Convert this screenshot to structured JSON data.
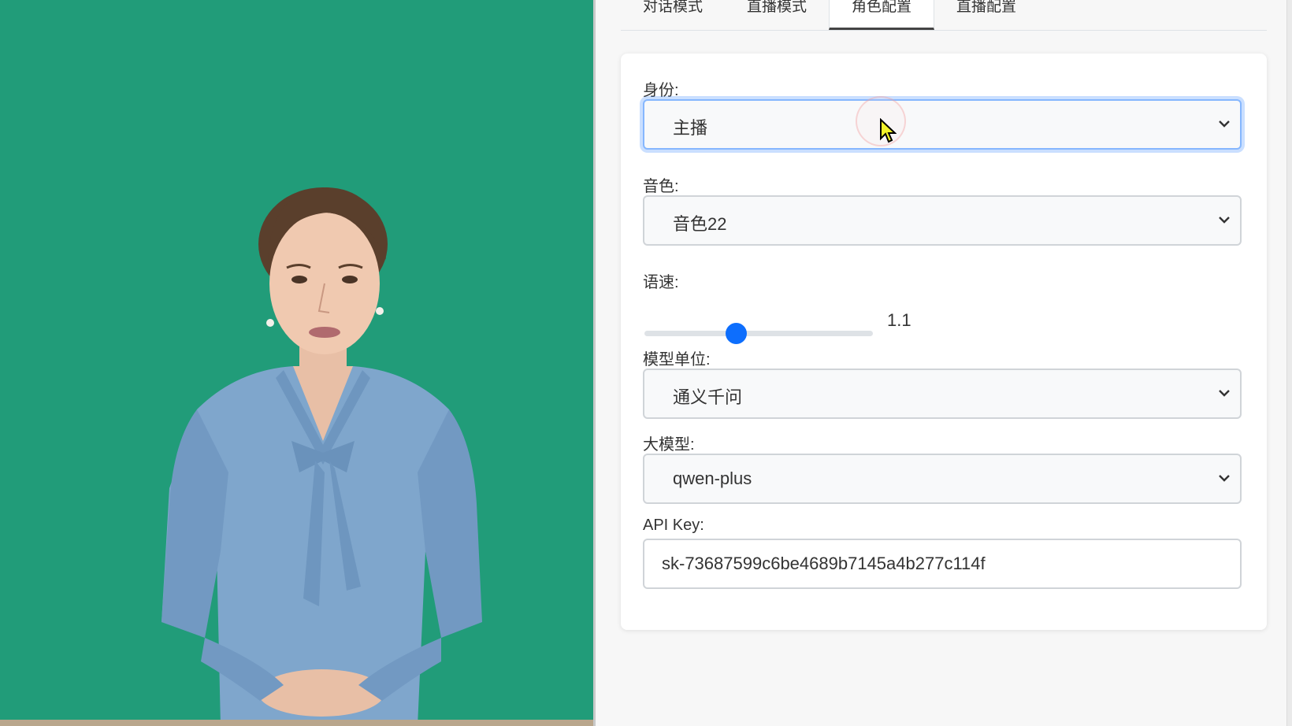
{
  "tabs": [
    {
      "label": "对话模式",
      "active": false
    },
    {
      "label": "直播模式",
      "active": false
    },
    {
      "label": "角色配置",
      "active": true
    },
    {
      "label": "直播配置",
      "active": false
    }
  ],
  "form": {
    "identity": {
      "label": "身份:",
      "value": "主播"
    },
    "voice": {
      "label": "音色:",
      "value": "音色22"
    },
    "speed": {
      "label": "语速:",
      "value": "1.1",
      "min": 0.5,
      "max": 2.0
    },
    "provider": {
      "label": "模型单位:",
      "value": "通义千问"
    },
    "model": {
      "label": "大模型:",
      "value": "qwen-plus"
    },
    "api_key": {
      "label": "API Key:",
      "value": "sk-73687599c6be4689b7145a4b277c114f"
    }
  },
  "colors": {
    "green_screen": "#219c79",
    "accent": "#0d6efd",
    "blouse": "#7fa6cc"
  },
  "icons": {
    "chevron": "chevron-down-icon",
    "cursor": "mouse-pointer-icon"
  }
}
